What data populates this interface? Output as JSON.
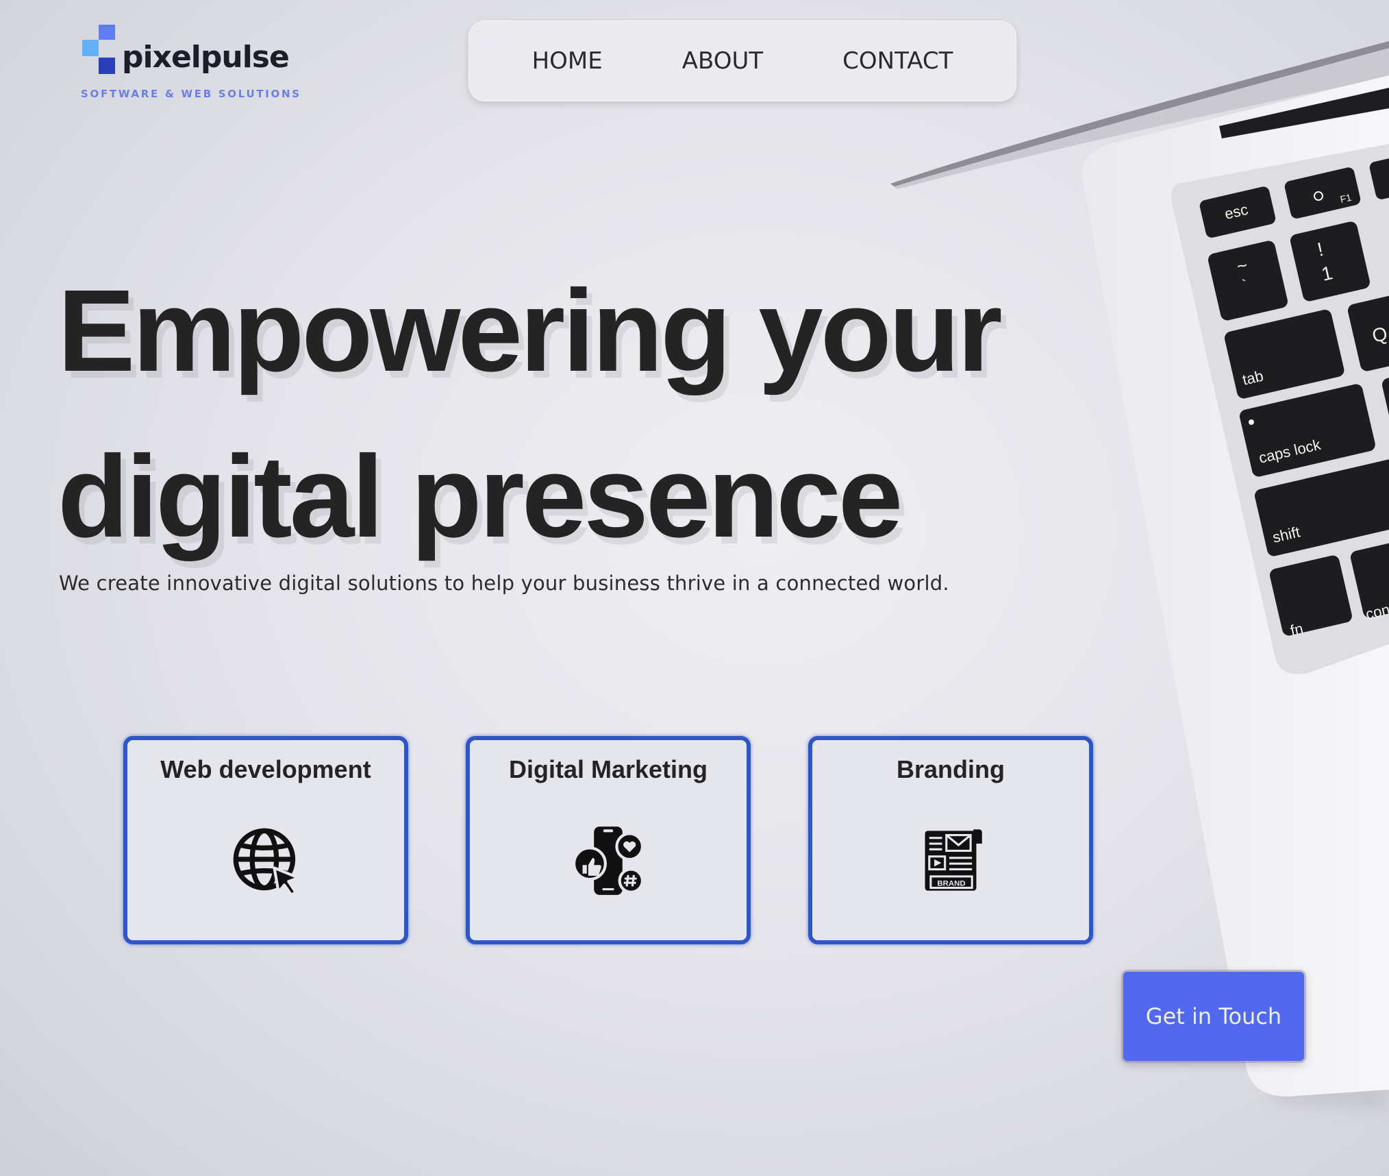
{
  "brand": {
    "name": "pixelpulse",
    "tagline": "SOFTWARE & WEB SOLUTIONS",
    "colors": {
      "accent": "#5168f0",
      "card_border": "#2d56c9",
      "logo_blue_dark": "#2b40b8",
      "logo_blue_light": "#62b1f8",
      "logo_blue_mid": "#5f7cf0"
    }
  },
  "nav": {
    "items": [
      {
        "label": "HOME"
      },
      {
        "label": "ABOUT"
      },
      {
        "label": "CONTACT"
      }
    ]
  },
  "hero": {
    "title_line1": "Empowering your",
    "title_line2": "digital presence",
    "subtitle": "We create innovative digital solutions to help your business thrive in a connected world."
  },
  "services": [
    {
      "title": "Web development",
      "icon": "globe-cursor-icon"
    },
    {
      "title": "Digital Marketing",
      "icon": "social-phone-icon"
    },
    {
      "title": "Branding",
      "icon": "brand-kit-icon"
    }
  ],
  "cta": {
    "label": "Get in Touch"
  },
  "keyboard": {
    "keys": [
      "esc",
      "F1",
      "~",
      "`",
      "!",
      "1",
      "tab",
      "Q",
      "caps lock",
      "shift",
      "fn",
      "con"
    ]
  }
}
